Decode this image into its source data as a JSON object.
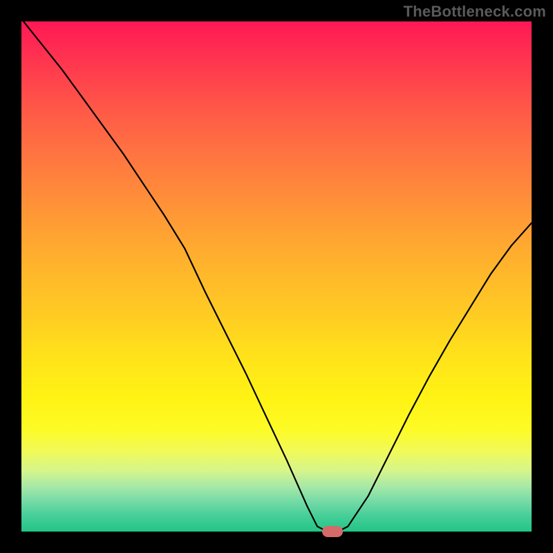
{
  "watermark": "TheBottleneck.com",
  "chart_data": {
    "type": "line",
    "x": [
      0.0,
      0.04,
      0.08,
      0.12,
      0.16,
      0.2,
      0.24,
      0.28,
      0.32,
      0.36,
      0.4,
      0.44,
      0.48,
      0.52,
      0.56,
      0.58,
      0.6,
      0.62,
      0.64,
      0.68,
      0.72,
      0.76,
      0.8,
      0.84,
      0.88,
      0.92,
      0.96,
      1.0
    ],
    "values": [
      1.005,
      0.955,
      0.905,
      0.85,
      0.795,
      0.74,
      0.68,
      0.62,
      0.555,
      0.47,
      0.39,
      0.31,
      0.225,
      0.14,
      0.05,
      0.01,
      0.0,
      0.0,
      0.01,
      0.07,
      0.15,
      0.23,
      0.305,
      0.375,
      0.44,
      0.505,
      0.56,
      0.605
    ],
    "title": "",
    "xlabel": "",
    "ylabel": "",
    "xlim": [
      0,
      1
    ],
    "ylim": [
      0,
      1
    ],
    "marker": {
      "x": 0.61,
      "y": 0.0
    },
    "colors": {
      "top": "#ff1855",
      "mid": "#ffe31a",
      "bottom": "#22c585",
      "line": "#000000",
      "marker": "#d46a6a",
      "watermark": "#5a5a5a"
    }
  }
}
